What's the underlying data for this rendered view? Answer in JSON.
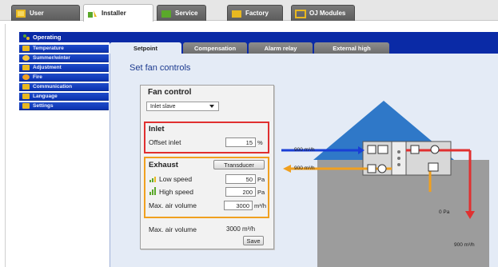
{
  "top_tabs": [
    {
      "label": "User",
      "icon": "user-icon",
      "active": false
    },
    {
      "label": "Installer",
      "icon": "installer-icon",
      "active": true
    },
    {
      "label": "Service",
      "icon": "service-icon",
      "active": false
    },
    {
      "label": "Factory",
      "icon": "factory-icon",
      "active": false
    },
    {
      "label": "OJ Modules",
      "icon": "modules-icon",
      "active": false
    }
  ],
  "sidebar": {
    "header": "Operating",
    "items": [
      {
        "label": "Temperature",
        "icon": "thermometer-icon"
      },
      {
        "label": "Summer/winter",
        "icon": "sun-icon"
      },
      {
        "label": "Adjustment",
        "icon": "wrench-icon"
      },
      {
        "label": "Fire",
        "icon": "fire-icon"
      },
      {
        "label": "Communication",
        "icon": "network-icon"
      },
      {
        "label": "Language",
        "icon": "flag-icon"
      },
      {
        "label": "Settings",
        "icon": "folder-icon"
      }
    ]
  },
  "sub_tabs": [
    {
      "label": "Setpoint",
      "active": true
    },
    {
      "label": "Compensation",
      "active": false
    },
    {
      "label": "Alarm relay",
      "active": false
    },
    {
      "label": "External high",
      "active": false
    }
  ],
  "page_title": "Set fan controls",
  "fan_control": {
    "title": "Fan control",
    "mode_selected": "Inlet slave",
    "inlet": {
      "heading": "Inlet",
      "offset_label": "Offset inlet",
      "offset_value": "15",
      "offset_unit": "%"
    },
    "exhaust": {
      "heading": "Exhaust",
      "transducer_label": "Transducer",
      "low_speed_label": "Low speed",
      "low_speed_value": "50",
      "low_speed_unit": "Pa",
      "high_speed_label": "High speed",
      "high_speed_value": "200",
      "high_speed_unit": "Pa",
      "max_air_label": "Max. air volume",
      "max_air_value": "3000",
      "max_air_unit": "m³/h"
    },
    "summary_max_air_label": "Max. air volume",
    "summary_max_air_value": "3000 m³/h",
    "save_label": "Save"
  },
  "diagram": {
    "inlet_flow": "900 m³/h",
    "exhaust_flow": "900 m³/h",
    "pressure": "0 Pa",
    "outlet_flow": "900 m³/h"
  },
  "colors": {
    "nav_blue": "#0a2aa6",
    "inlet_red": "#e03030",
    "exhaust_orange": "#f0a020",
    "roof_blue": "#2f78c8"
  }
}
